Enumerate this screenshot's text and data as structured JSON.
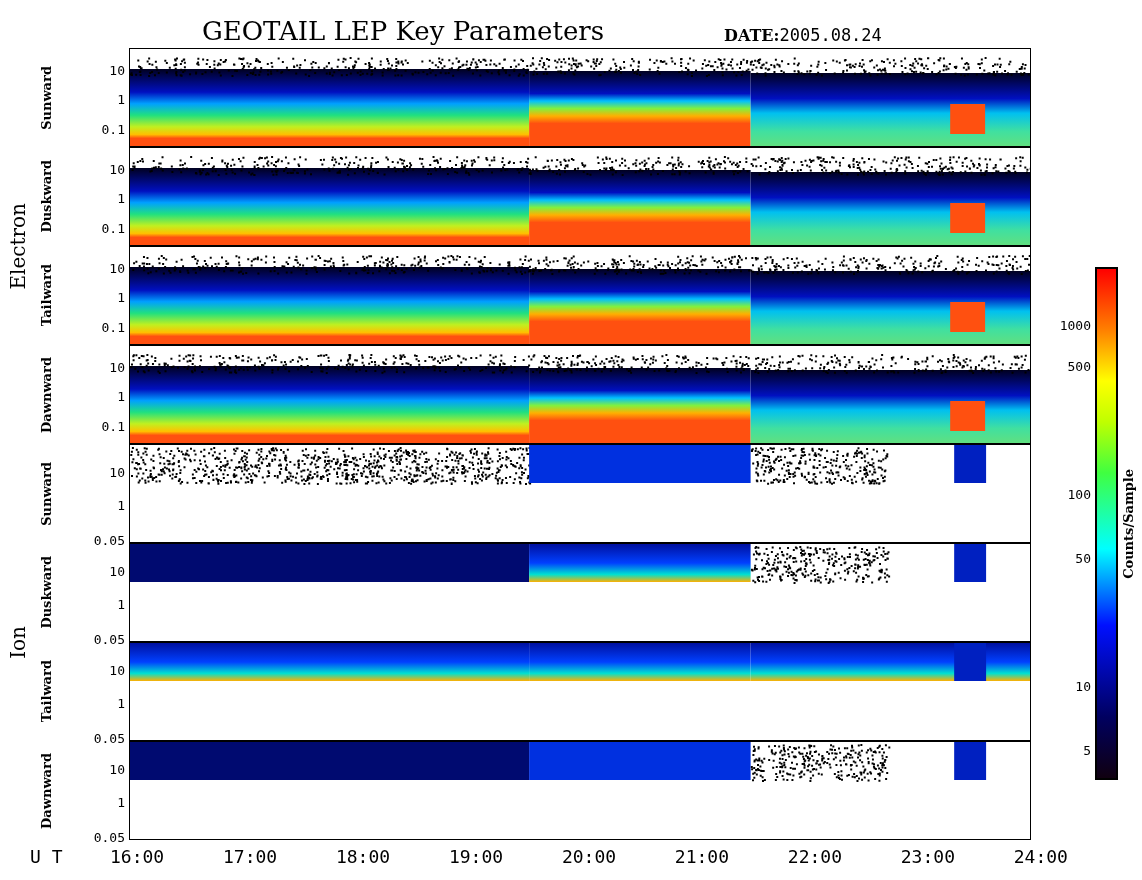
{
  "title": "GEOTAIL LEP Key Parameters",
  "date": {
    "label": "DATE:",
    "value": "2005.08.24"
  },
  "groups": [
    {
      "name": "Electron",
      "panels": [
        {
          "label": "Sunward",
          "kind": "electron",
          "yticks": [
            "10",
            "1",
            "0.1"
          ]
        },
        {
          "label": "Duskward",
          "kind": "electron",
          "yticks": [
            "10",
            "1",
            "0.1"
          ]
        },
        {
          "label": "Tailward",
          "kind": "electron",
          "yticks": [
            "10",
            "1",
            "0.1"
          ]
        },
        {
          "label": "Dawnward",
          "kind": "electron",
          "yticks": [
            "10",
            "1",
            "0.1"
          ]
        }
      ]
    },
    {
      "name": "Ion",
      "panels": [
        {
          "label": "Sunward",
          "kind": "ion",
          "yticks": [
            "10",
            "1",
            "0.05"
          ]
        },
        {
          "label": "Duskward",
          "kind": "ion",
          "yticks": [
            "10",
            "1",
            "0.05"
          ]
        },
        {
          "label": "Tailward",
          "kind": "ion",
          "yticks": [
            "10",
            "1",
            "0.05"
          ]
        },
        {
          "label": "Dawnward",
          "kind": "ion",
          "yticks": [
            "10",
            "1",
            "0.05"
          ]
        }
      ]
    }
  ],
  "colorbar": {
    "label": "Counts/Sample",
    "ticks": [
      "1000",
      "500",
      "100",
      "50",
      "10",
      "5"
    ]
  },
  "xaxis": {
    "label": "U T",
    "ticks": [
      "16:00",
      "17:00",
      "18:00",
      "19:00",
      "20:00",
      "21:00",
      "22:00",
      "23:00",
      "24:00"
    ]
  }
}
